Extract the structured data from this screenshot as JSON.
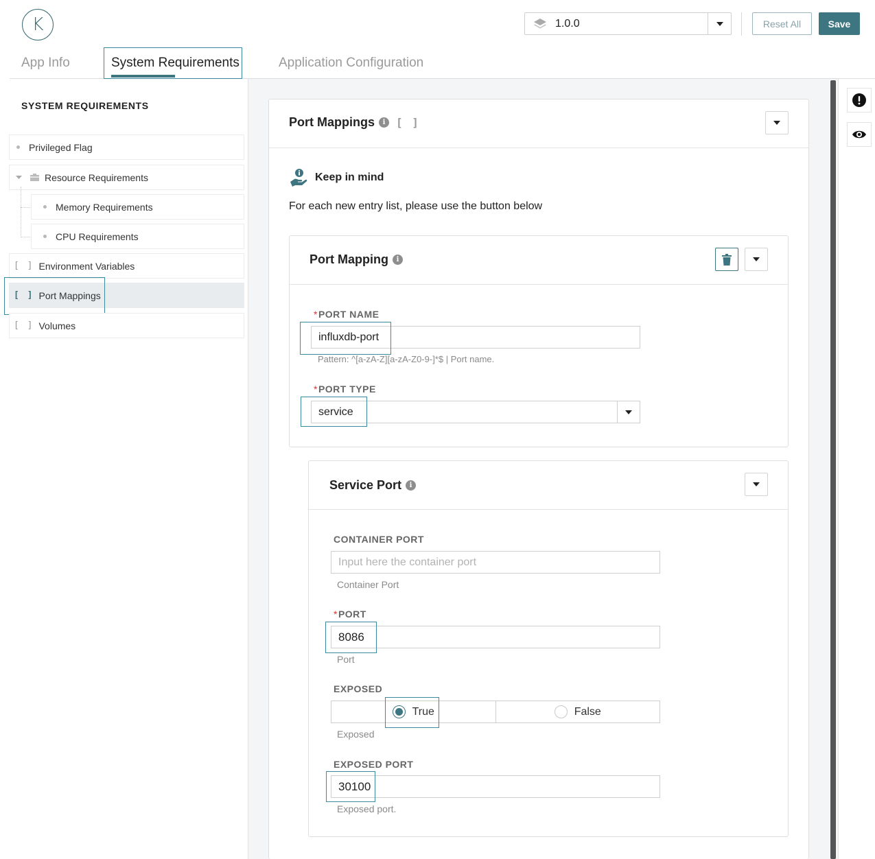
{
  "header": {
    "logo_letter": "K",
    "version": "1.0.0",
    "reset_label": "Reset All",
    "save_label": "Save"
  },
  "tabs": [
    {
      "label": "App Info"
    },
    {
      "label": "System Requirements"
    },
    {
      "label": "Application Configuration"
    }
  ],
  "sidebar": {
    "title": "SYSTEM REQUIREMENTS",
    "items": [
      {
        "label": "Privileged Flag"
      },
      {
        "label": "Resource Requirements"
      },
      {
        "label": "Memory Requirements"
      },
      {
        "label": "CPU Requirements"
      },
      {
        "label": "Environment Variables",
        "prefix": "[ ]"
      },
      {
        "label": "Port Mappings",
        "prefix": "[ ]"
      },
      {
        "label": "Volumes",
        "prefix": "[ ]"
      }
    ]
  },
  "port_mappings": {
    "title": "Port Mappings",
    "suffix": "[ ]",
    "keep_in_mind": "Keep in mind",
    "instruction": "For each new entry list, please use the button below"
  },
  "port_mapping": {
    "title": "Port Mapping",
    "port_name_label": "PORT NAME",
    "port_name_value": "influxdb-port",
    "port_name_help": "Pattern: ^[a-zA-Z][a-zA-Z0-9-]*$ | Port name.",
    "port_type_label": "PORT TYPE",
    "port_type_value": "service"
  },
  "service_port": {
    "title": "Service Port",
    "container_port_label": "CONTAINER PORT",
    "container_port_placeholder": "Input here the container port",
    "container_port_help": "Container Port",
    "port_label": "PORT",
    "port_value": "8086",
    "port_help": "Port",
    "exposed_label": "EXPOSED",
    "exposed_true": "True",
    "exposed_false": "False",
    "exposed_help": "Exposed",
    "exposed_port_label": "EXPOSED PORT",
    "exposed_port_value": "30100",
    "exposed_port_help": "Exposed port."
  },
  "colors": {
    "accent": "#3d7580",
    "highlight": "#3a8aa0",
    "required": "#dd3333"
  }
}
